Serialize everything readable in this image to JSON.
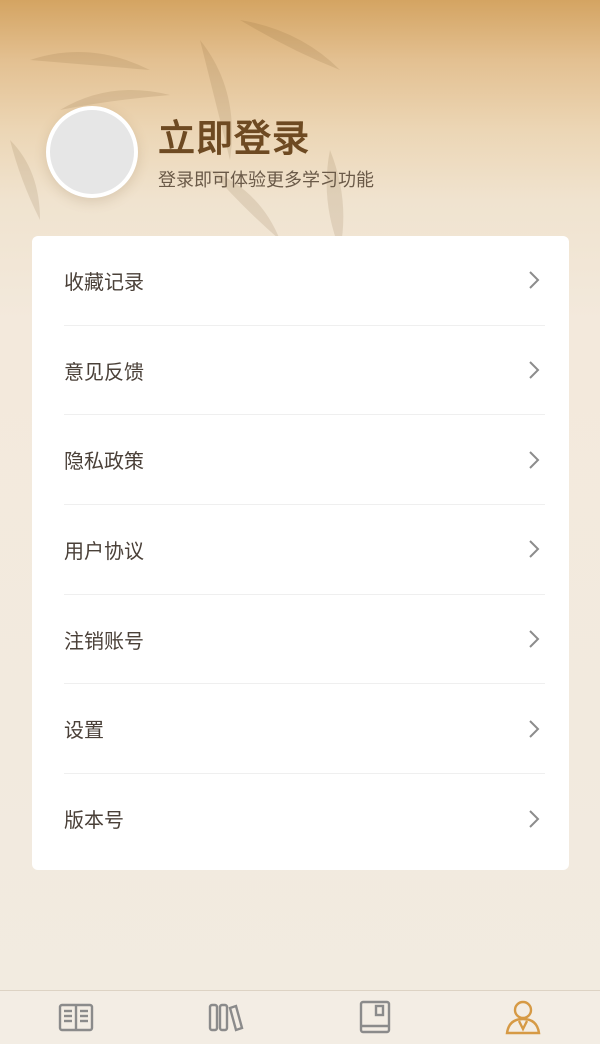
{
  "profile": {
    "title": "立即登录",
    "subtitle": "登录即可体验更多学习功能",
    "avatar_icon": "avatar-placeholder"
  },
  "menu": [
    {
      "label": "收藏记录",
      "icon": "chevron-right-icon"
    },
    {
      "label": "意见反馈",
      "icon": "chevron-right-icon"
    },
    {
      "label": "隐私政策",
      "icon": "chevron-right-icon"
    },
    {
      "label": "用户协议",
      "icon": "chevron-right-icon"
    },
    {
      "label": "注销账号",
      "icon": "chevron-right-icon"
    },
    {
      "label": "设置",
      "icon": "chevron-right-icon"
    },
    {
      "label": "版本号",
      "icon": "chevron-right-icon"
    }
  ],
  "tabbar": {
    "tabs": [
      {
        "icon": "open-book-icon",
        "active": false
      },
      {
        "icon": "bookshelf-icon",
        "active": false
      },
      {
        "icon": "notebook-icon",
        "active": false
      },
      {
        "icon": "profile-icon",
        "active": true
      }
    ],
    "colors": {
      "active": "#d69a45",
      "inactive": "#8b8b8b"
    }
  },
  "colors": {
    "title": "#6e4a22",
    "header_gradient_top": "#d4a462",
    "background": "#f2ebe0"
  }
}
